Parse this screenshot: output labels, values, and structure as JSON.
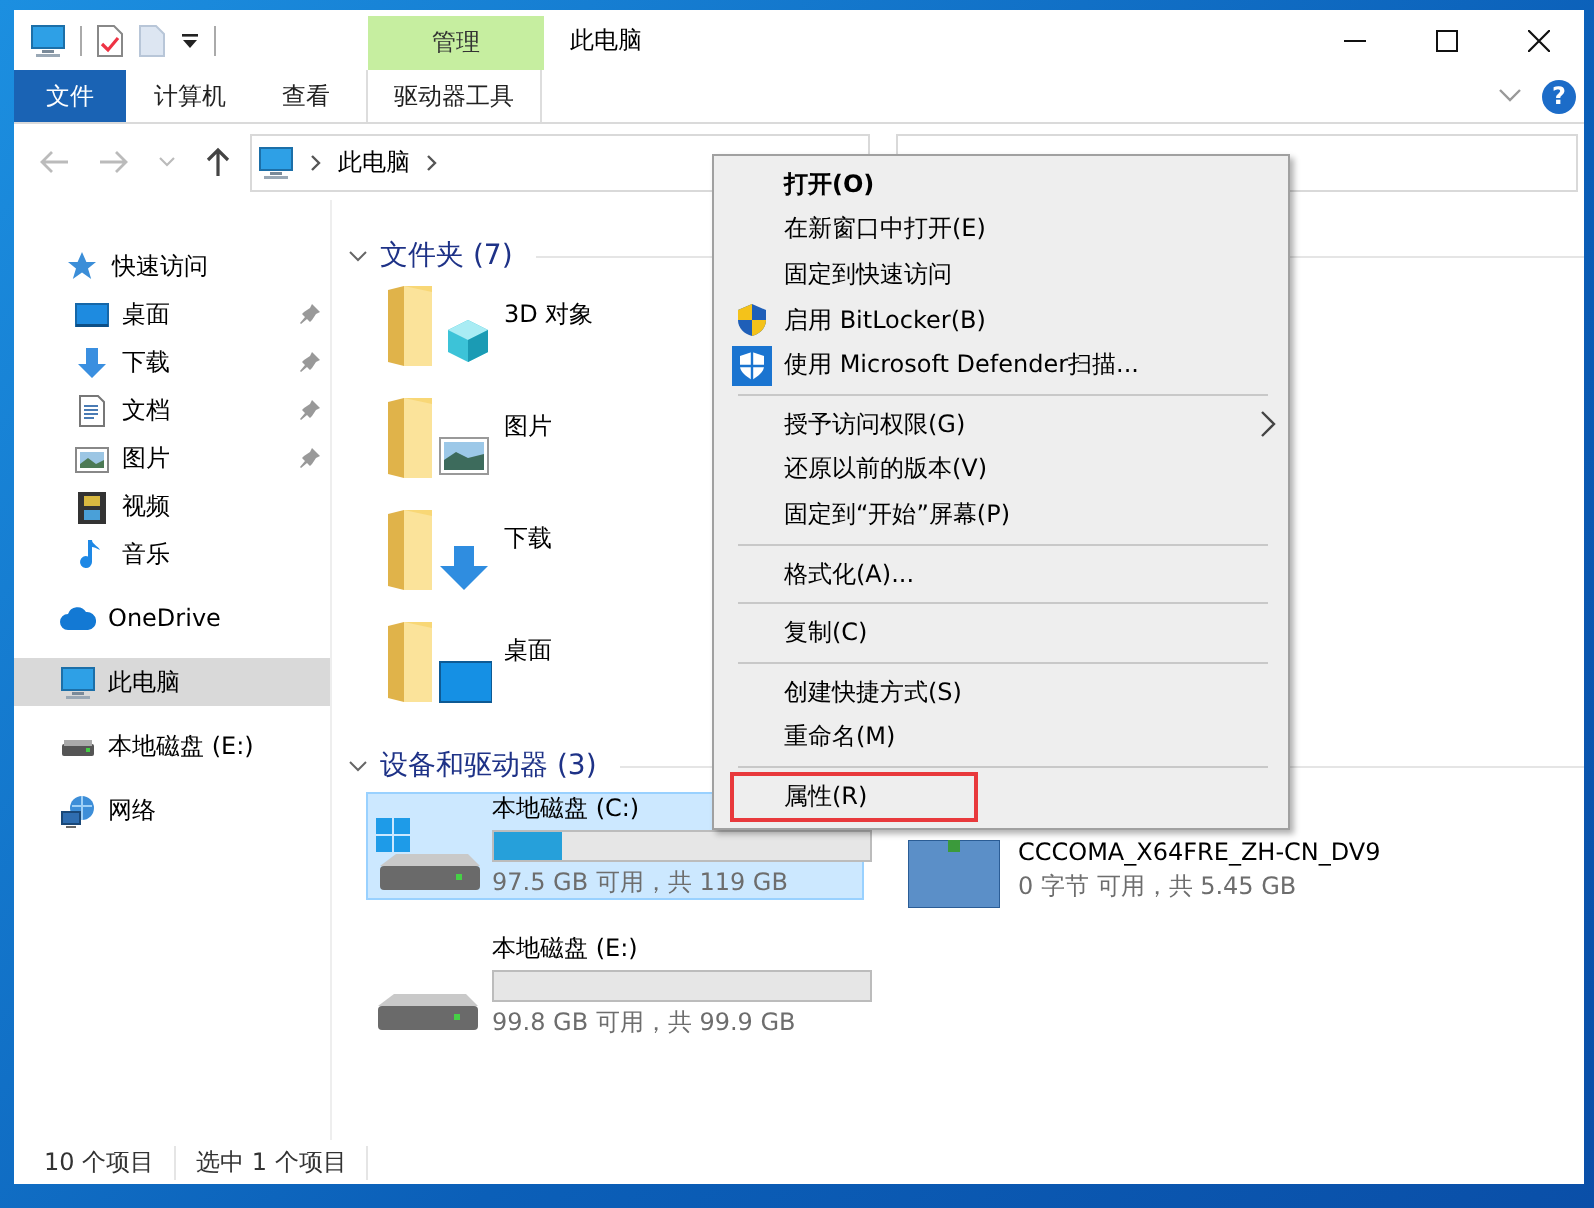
{
  "window": {
    "title": "此电脑"
  },
  "contextual_group": {
    "label": "管理"
  },
  "ribbon_tabs": [
    {
      "label": "文件",
      "kind": "file"
    },
    {
      "label": "计算机",
      "kind": "plain"
    },
    {
      "label": "查看",
      "kind": "plain"
    },
    {
      "label": "驱动器工具",
      "kind": "tool"
    }
  ],
  "help": "?",
  "address": {
    "path": [
      "此电脑"
    ]
  },
  "sidebar": {
    "items": [
      {
        "label": "快速访问",
        "selected": false,
        "children": [
          {
            "label": "桌面",
            "pinned": true,
            "selected": false
          },
          {
            "label": "下载",
            "pinned": true,
            "selected": false
          },
          {
            "label": "文档",
            "pinned": true,
            "selected": false
          },
          {
            "label": "图片",
            "pinned": true,
            "selected": false
          },
          {
            "label": "视频",
            "pinned": false,
            "selected": false
          },
          {
            "label": "音乐",
            "pinned": false,
            "selected": false
          }
        ]
      },
      {
        "label": "OneDrive",
        "selected": false
      },
      {
        "label": "此电脑",
        "selected": true
      },
      {
        "label": "本地磁盘 (E:)",
        "selected": false
      },
      {
        "label": "网络",
        "selected": false
      }
    ]
  },
  "groups": [
    {
      "title": "文件夹 (7)",
      "expanded": true,
      "kind": "folders",
      "items": [
        {
          "label": "3D 对象"
        },
        {
          "label": "图片"
        },
        {
          "label": "下载"
        },
        {
          "label": "桌面"
        }
      ]
    },
    {
      "title": "设备和驱动器 (3)",
      "expanded": true,
      "kind": "drives",
      "items": [
        {
          "label": "本地磁盘 (C:)",
          "info": "97.5 GB 可用，共 119 GB",
          "level": 0.18,
          "selected": true
        },
        {
          "label": "CCCOMA_X64FRE_ZH-CN_DV9",
          "info": "0 字节 可用，共 5.45 GB",
          "selected": false
        },
        {
          "label": "本地磁盘 (E:)",
          "info": "99.8 GB 可用，共 99.9 GB",
          "level": 0,
          "selected": false
        }
      ]
    }
  ],
  "context_menu": {
    "items": [
      {
        "kind": "item",
        "label": "打开(O)",
        "bold": true
      },
      {
        "kind": "item",
        "label": "在新窗口中打开(E)"
      },
      {
        "kind": "item",
        "label": "固定到快速访问"
      },
      {
        "kind": "item",
        "label": "启用 BitLocker(B)"
      },
      {
        "kind": "item",
        "label": "使用 Microsoft Defender扫描..."
      },
      {
        "kind": "separator"
      },
      {
        "kind": "item",
        "label": "授予访问权限(G)",
        "submenu": true
      },
      {
        "kind": "item",
        "label": "还原以前的版本(V)"
      },
      {
        "kind": "item",
        "label": "固定到“开始”屏幕(P)"
      },
      {
        "kind": "separator"
      },
      {
        "kind": "item",
        "label": "格式化(A)..."
      },
      {
        "kind": "separator"
      },
      {
        "kind": "item",
        "label": "复制(C)"
      },
      {
        "kind": "separator"
      },
      {
        "kind": "item",
        "label": "创建快捷方式(S)"
      },
      {
        "kind": "item",
        "label": "重命名(M)"
      },
      {
        "kind": "separator"
      },
      {
        "kind": "item",
        "label": "属性(R)",
        "highlighted": true
      }
    ]
  },
  "status_bar": [
    "10 个项目",
    "选中 1 个项目"
  ]
}
